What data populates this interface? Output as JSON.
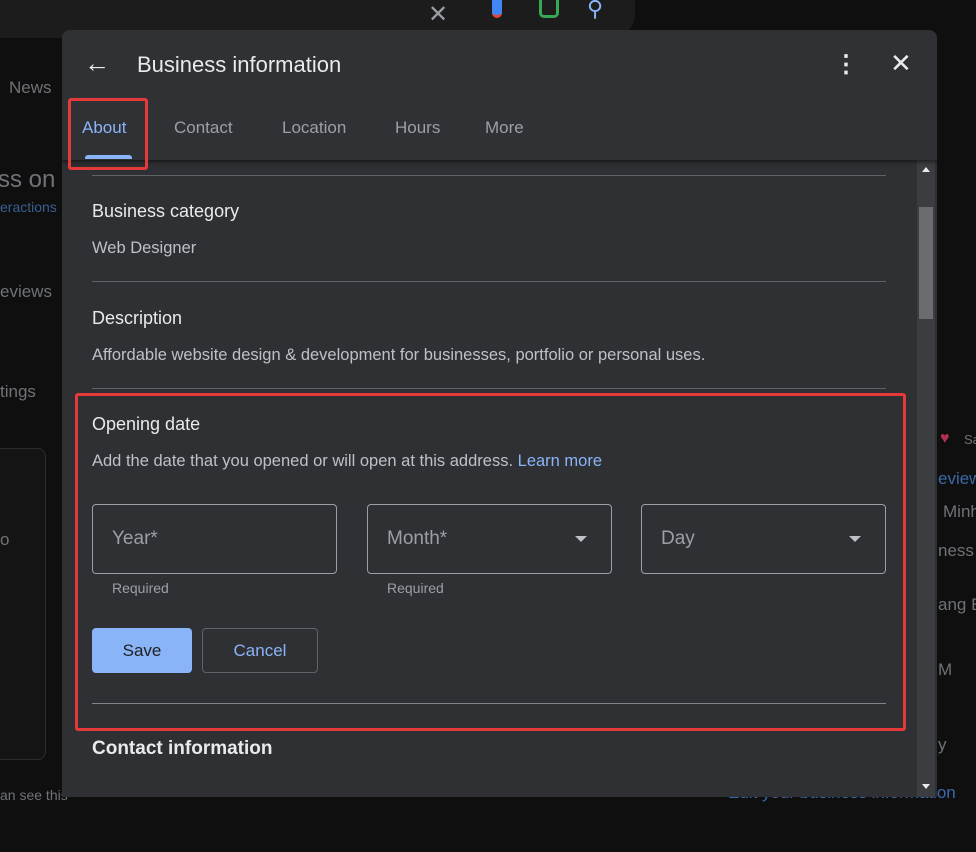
{
  "background": {
    "left_texts": [
      "News",
      "ss on G",
      "eractions",
      "eviews",
      "tings",
      "o",
      "an see this"
    ],
    "right_texts": [
      "Sa",
      "eviews",
      "Minh",
      "ness",
      "ang E",
      "M",
      "y",
      "Edit your business information"
    ]
  },
  "modal": {
    "title": "Business information",
    "tabs": [
      {
        "label": "About",
        "active": true
      },
      {
        "label": "Contact"
      },
      {
        "label": "Location"
      },
      {
        "label": "Hours"
      },
      {
        "label": "More"
      }
    ],
    "sections": {
      "category": {
        "label": "Business category",
        "value": "Web Designer"
      },
      "description": {
        "label": "Description",
        "value": "Affordable website design & development for businesses, portfolio or personal uses."
      },
      "opening_date": {
        "label": "Opening date",
        "help": "Add the date that you opened or will open at this address.",
        "learn_more": "Learn more",
        "year": {
          "placeholder": "Year*",
          "helper": "Required"
        },
        "month": {
          "placeholder": "Month*",
          "helper": "Required"
        },
        "day": {
          "placeholder": "Day"
        },
        "save": "Save",
        "cancel": "Cancel"
      },
      "contact": {
        "label": "Contact information"
      }
    }
  },
  "colors": {
    "accent": "#8ab4f8",
    "highlight": "#e5393a"
  }
}
